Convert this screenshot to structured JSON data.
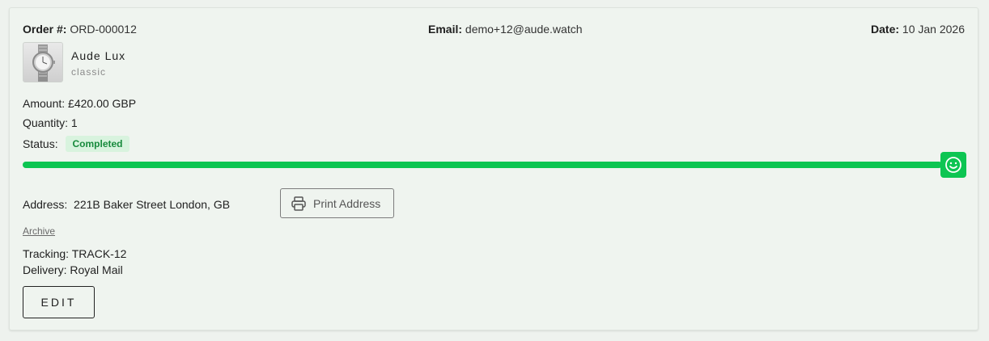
{
  "order": {
    "number_label": "Order #:",
    "number": "ORD-000012",
    "email_label": "Email:",
    "email": "demo+12@aude.watch",
    "date_label": "Date:",
    "date": "10 Jan 2026"
  },
  "product": {
    "name": "Aude Lux",
    "variant": "classic",
    "image_icon": "watch-image"
  },
  "details": {
    "amount_label": "Amount:",
    "amount": "£420.00 GBP",
    "quantity_label": "Quantity:",
    "quantity": "1",
    "status_label": "Status:",
    "status": "Completed"
  },
  "progress": {
    "fraction": 1.0,
    "handle_icon": "smile-icon",
    "color": "#0dc552"
  },
  "address": {
    "label": "Address:",
    "value": "221B Baker Street London, GB",
    "print_label": "Print Address",
    "print_icon": "printer-icon"
  },
  "archive_label": "Archive",
  "shipping": {
    "tracking_label": "Tracking:",
    "tracking": "TRACK-12",
    "delivery_label": "Delivery:",
    "delivery": "Royal Mail"
  },
  "actions": {
    "edit_label": "EDIT"
  },
  "colors": {
    "accent": "#0dc552",
    "badge_bg": "#d8f3de",
    "badge_text": "#178a3c",
    "card_bg": "#eff4ef"
  }
}
